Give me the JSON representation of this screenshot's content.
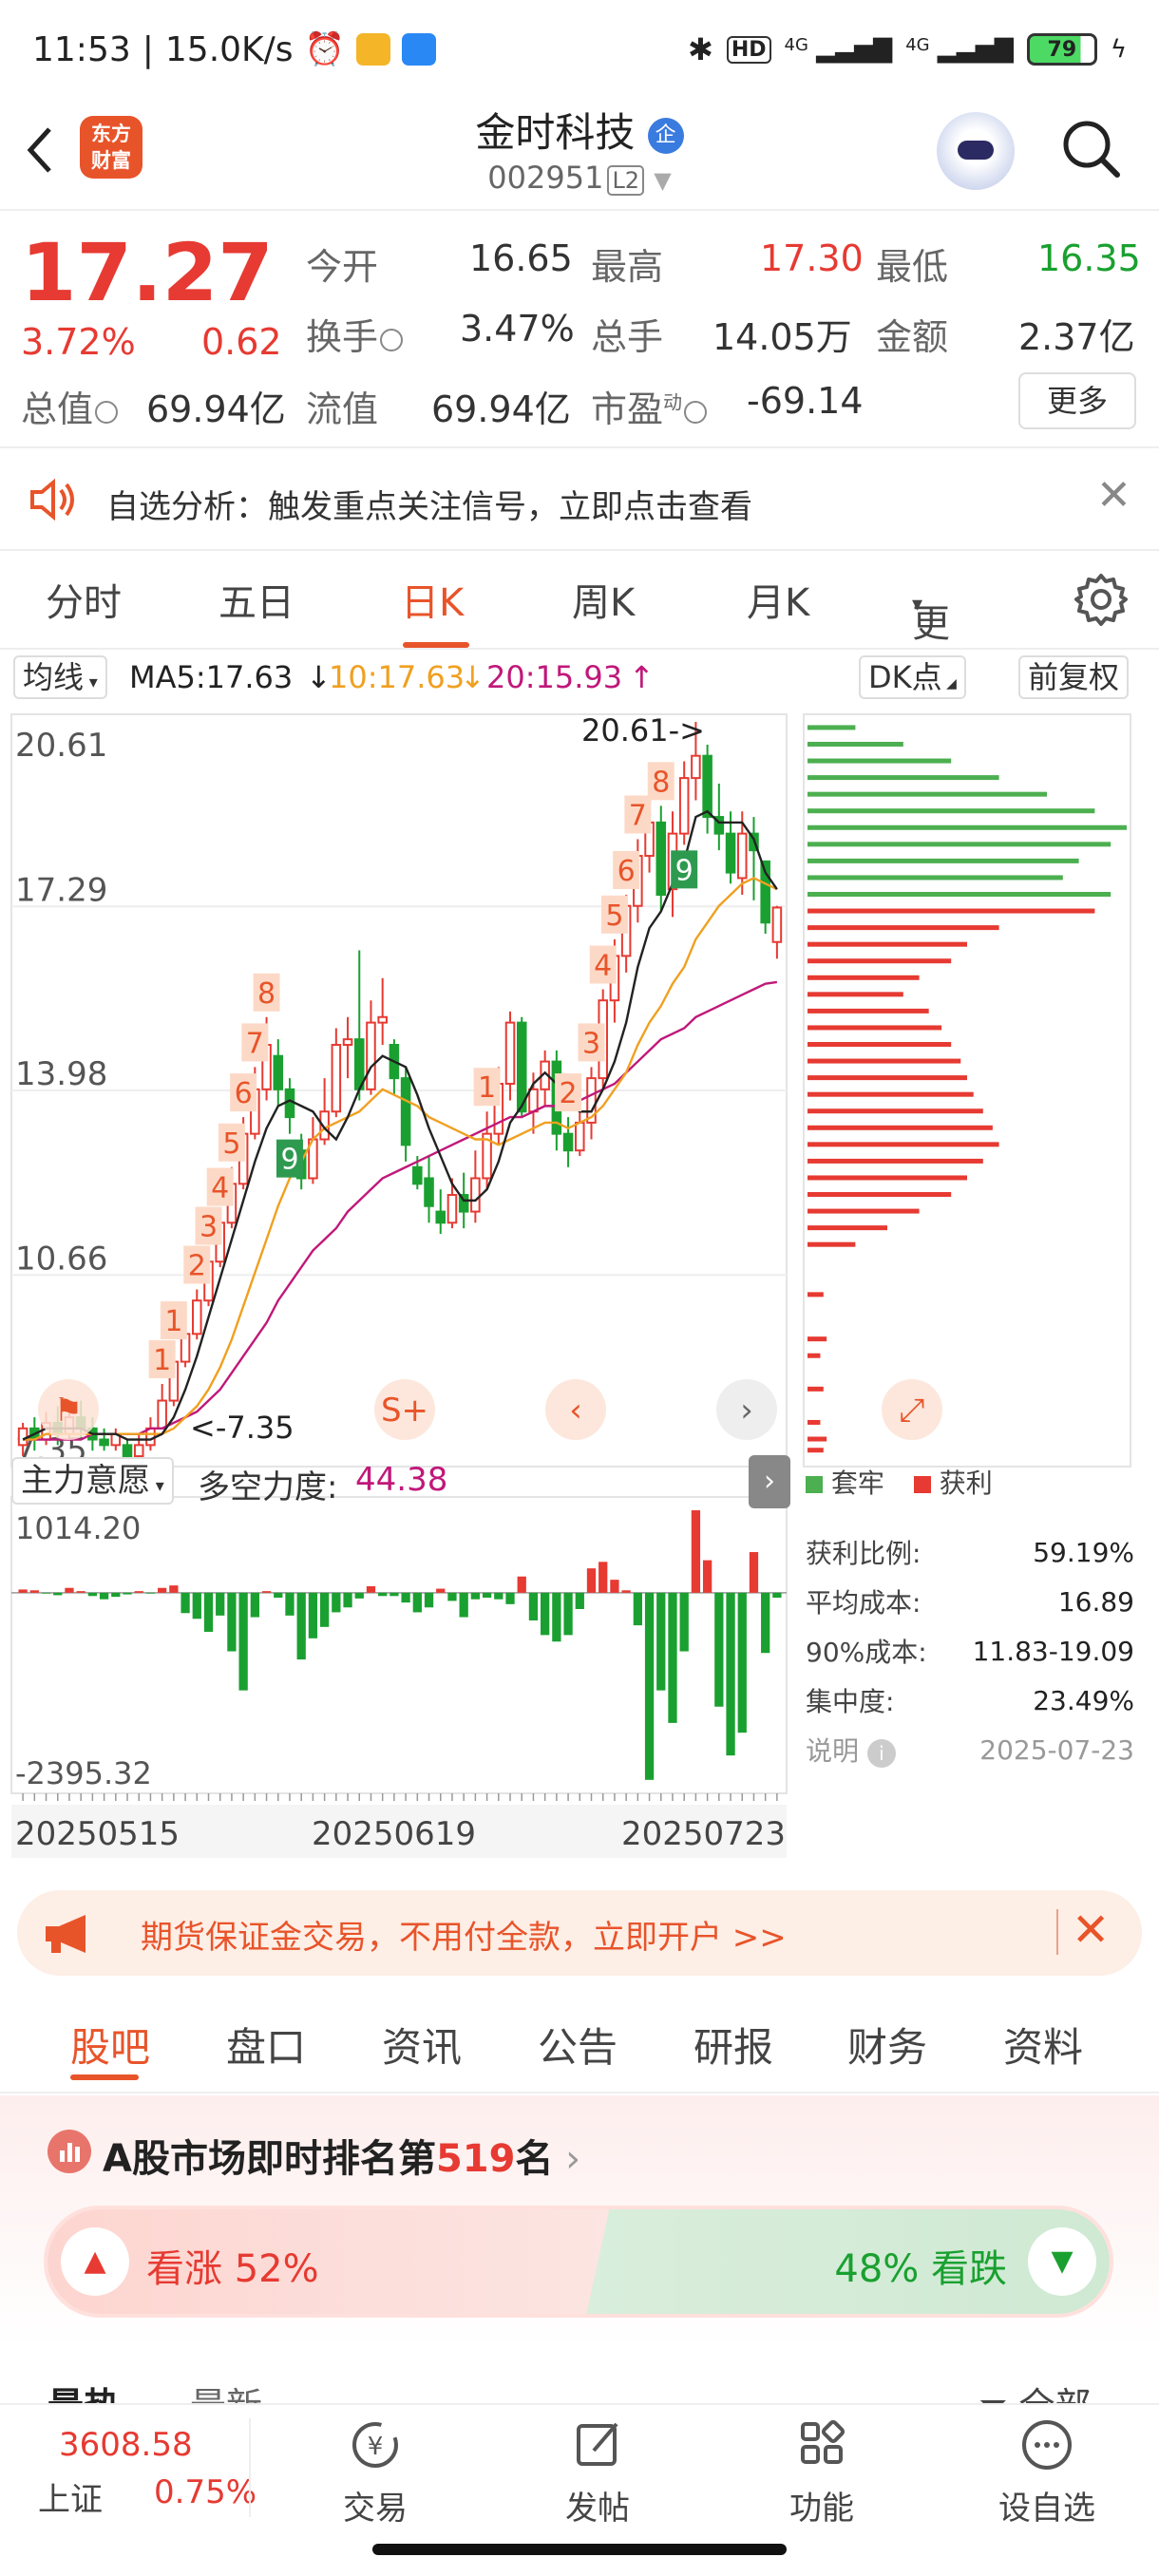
{
  "status_bar": {
    "time": "11:53",
    "net_speed": "15.0K/s",
    "battery": "79",
    "hd": "HD",
    "net1": "4G",
    "net2": "4G"
  },
  "header": {
    "back_icon": "chevron-left-icon",
    "logo_line1": "东方",
    "logo_line2": "财富",
    "stock_name": "金时科技",
    "badge": "企",
    "code": "002951",
    "level": "L2"
  },
  "quote": {
    "price": "17.27",
    "change_pct": "3.72%",
    "change": "0.62",
    "open_label": "今开",
    "open": "16.65",
    "high_label": "最高",
    "high": "17.30",
    "low_label": "最低",
    "low": "16.35",
    "turnover_label": "换手",
    "turnover": "3.47%",
    "volume_label": "总手",
    "volume": "14.05万",
    "amount_label": "金额",
    "amount": "2.37亿",
    "mktcap_label": "总值",
    "mktcap": "69.94亿",
    "float_label": "流值",
    "float": "69.94亿",
    "pe_label": "市盈",
    "pe_sup": "动",
    "pe": "-69.14",
    "more": "更多"
  },
  "alert": {
    "text": "自选分析：触发重点关注信号，立即点击查看"
  },
  "period_tabs": [
    "分时",
    "五日",
    "日K",
    "周K",
    "月K",
    "更多"
  ],
  "active_tab": 2,
  "ma_bar": {
    "type": "均线",
    "ma5": "MA5:17.63",
    "ma10": "10:17.63",
    "ma20": "20:15.93",
    "dk": "DK点",
    "adjust": "前复权"
  },
  "chart_data": {
    "type": "candlestick",
    "title": "",
    "y_ticks": [
      "20.61",
      "17.29",
      "13.98",
      "10.66",
      "7.35"
    ],
    "ylim": [
      7.35,
      20.61
    ],
    "max_label": "20.61->",
    "min_label": "<-7.35",
    "sequence_labels": [
      "1",
      "2",
      "3",
      "4",
      "5",
      "6",
      "7",
      "8",
      "9"
    ],
    "candles": [
      [
        7.6,
        7.9,
        7.4,
        8.0
      ],
      [
        7.9,
        7.7,
        7.5,
        8.1
      ],
      [
        7.7,
        8.0,
        7.6,
        8.2
      ],
      [
        8.0,
        7.8,
        7.6,
        8.3
      ],
      [
        7.8,
        8.1,
        7.7,
        8.3
      ],
      [
        8.1,
        7.9,
        7.7,
        8.4
      ],
      [
        7.9,
        7.7,
        7.5,
        8.1
      ],
      [
        7.7,
        7.6,
        7.5,
        7.9
      ],
      [
        7.6,
        7.8,
        7.5,
        7.9
      ],
      [
        7.6,
        7.4,
        7.35,
        7.7
      ],
      [
        7.4,
        7.6,
        7.35,
        7.8
      ],
      [
        7.6,
        7.9,
        7.5,
        8.1
      ],
      [
        7.9,
        8.4,
        7.9,
        8.7
      ],
      [
        8.4,
        9.1,
        8.3,
        9.4
      ],
      [
        9.1,
        9.6,
        9.0,
        9.8
      ],
      [
        9.6,
        10.2,
        9.5,
        10.4
      ],
      [
        10.2,
        10.9,
        10.1,
        11.1
      ],
      [
        10.9,
        11.6,
        10.8,
        11.8
      ],
      [
        11.6,
        12.3,
        11.5,
        12.6
      ],
      [
        12.3,
        13.2,
        12.2,
        13.5
      ],
      [
        13.2,
        14.0,
        13.1,
        14.4
      ],
      [
        14.0,
        14.8,
        13.8,
        15.3
      ],
      [
        14.6,
        14.0,
        13.7,
        14.9
      ],
      [
        14.0,
        13.5,
        13.2,
        14.2
      ],
      [
        12.9,
        12.4,
        12.2,
        13.2
      ],
      [
        12.4,
        13.1,
        12.3,
        13.5
      ],
      [
        13.1,
        13.6,
        13.0,
        14.2
      ],
      [
        13.6,
        14.8,
        13.5,
        15.1
      ],
      [
        14.8,
        14.9,
        14.2,
        15.3
      ],
      [
        14.9,
        14.0,
        13.8,
        16.5
      ],
      [
        14.0,
        15.2,
        13.9,
        15.6
      ],
      [
        15.2,
        15.3,
        14.8,
        16.0
      ],
      [
        14.8,
        14.2,
        13.9,
        14.9
      ],
      [
        14.2,
        13.0,
        12.7,
        14.4
      ],
      [
        12.6,
        12.3,
        12.2,
        12.8
      ],
      [
        12.4,
        11.9,
        11.6,
        12.8
      ],
      [
        11.8,
        11.6,
        11.4,
        12.2
      ],
      [
        11.6,
        12.1,
        11.5,
        12.4
      ],
      [
        12.1,
        11.8,
        11.5,
        12.5
      ],
      [
        11.8,
        12.4,
        11.6,
        12.9
      ],
      [
        12.4,
        13.2,
        12.2,
        13.6
      ],
      [
        13.2,
        14.1,
        13.0,
        14.4
      ],
      [
        14.1,
        15.2,
        13.8,
        15.4
      ],
      [
        15.2,
        13.6,
        13.5,
        15.3
      ],
      [
        13.6,
        14.0,
        13.2,
        14.3
      ],
      [
        14.0,
        14.5,
        13.7,
        14.7
      ],
      [
        14.5,
        13.2,
        12.9,
        14.7
      ],
      [
        13.2,
        12.9,
        12.6,
        13.5
      ],
      [
        12.9,
        13.4,
        12.8,
        13.7
      ],
      [
        13.4,
        14.2,
        13.1,
        14.4
      ],
      [
        14.2,
        15.6,
        14.0,
        15.8
      ],
      [
        15.6,
        16.4,
        15.2,
        16.7
      ],
      [
        16.4,
        17.3,
        16.1,
        17.5
      ],
      [
        17.3,
        18.2,
        17.0,
        18.5
      ],
      [
        18.2,
        18.8,
        17.9,
        19.1
      ],
      [
        18.8,
        17.5,
        17.2,
        19.1
      ],
      [
        17.6,
        18.6,
        17.1,
        19.0
      ],
      [
        18.6,
        19.6,
        18.4,
        19.9
      ],
      [
        19.6,
        20.0,
        19.2,
        20.61
      ],
      [
        20.0,
        18.9,
        18.6,
        20.2
      ],
      [
        18.9,
        18.6,
        18.3,
        19.5
      ],
      [
        18.6,
        17.9,
        17.7,
        19.0
      ],
      [
        17.8,
        18.6,
        17.5,
        19.0
      ],
      [
        18.6,
        18.3,
        17.4,
        18.9
      ],
      [
        18.1,
        17.0,
        16.8,
        18.1
      ],
      [
        16.65,
        17.27,
        16.35,
        17.3
      ]
    ],
    "ma5": [
      7.7,
      7.8,
      7.9,
      7.9,
      7.9,
      7.9,
      7.8,
      7.8,
      7.8,
      7.7,
      7.7,
      7.7,
      7.8,
      8.1,
      8.6,
      9.2,
      9.9,
      10.6,
      11.3,
      12.0,
      12.7,
      13.3,
      13.7,
      13.8,
      13.7,
      13.6,
      13.3,
      13.1,
      13.5,
      14.0,
      14.4,
      14.6,
      14.5,
      14.4,
      13.9,
      13.3,
      12.8,
      12.3,
      12.0,
      12.0,
      12.2,
      12.7,
      13.4,
      13.7,
      14.1,
      14.3,
      14.1,
      13.8,
      13.6,
      13.6,
      14.0,
      14.5,
      15.2,
      16.2,
      16.9,
      17.2,
      17.7,
      18.1,
      18.9,
      19.0,
      18.8,
      18.8,
      18.8,
      18.5,
      17.9,
      17.6
    ],
    "ma10": [
      7.7,
      7.7,
      7.8,
      7.8,
      7.8,
      7.8,
      7.8,
      7.8,
      7.8,
      7.8,
      7.8,
      7.8,
      7.8,
      7.9,
      8.1,
      8.3,
      8.6,
      9.0,
      9.5,
      10.1,
      10.7,
      11.3,
      11.9,
      12.4,
      12.7,
      13.1,
      13.3,
      13.4,
      13.5,
      13.6,
      13.8,
      14.0,
      13.9,
      13.8,
      13.7,
      13.5,
      13.4,
      13.3,
      13.2,
      13.1,
      13.1,
      13.0,
      13.1,
      13.2,
      13.3,
      13.4,
      13.4,
      13.3,
      13.4,
      13.5,
      13.7,
      14.0,
      14.3,
      14.8,
      15.2,
      15.5,
      15.9,
      16.2,
      16.7,
      17.0,
      17.3,
      17.5,
      17.7,
      17.8,
      17.7,
      17.6
    ],
    "ma20": [
      7.7,
      7.7,
      7.7,
      7.7,
      7.7,
      7.7,
      7.8,
      7.8,
      7.8,
      7.8,
      7.8,
      7.9,
      7.9,
      8.0,
      8.1,
      8.2,
      8.4,
      8.6,
      8.9,
      9.2,
      9.5,
      9.8,
      10.2,
      10.5,
      10.8,
      11.1,
      11.3,
      11.5,
      11.8,
      12.0,
      12.2,
      12.4,
      12.5,
      12.6,
      12.7,
      12.8,
      12.9,
      13.0,
      13.1,
      13.2,
      13.3,
      13.4,
      13.5,
      13.5,
      13.6,
      13.7,
      13.7,
      13.8,
      13.8,
      13.9,
      14.0,
      14.1,
      14.3,
      14.5,
      14.7,
      14.9,
      15.0,
      15.1,
      15.3,
      15.4,
      15.5,
      15.6,
      15.7,
      15.8,
      15.9,
      15.93
    ],
    "flow": [
      40,
      30,
      -10,
      -30,
      60,
      20,
      -40,
      -80,
      -50,
      -20,
      20,
      -10,
      60,
      90,
      -250,
      -320,
      -480,
      -280,
      -720,
      -1200,
      -300,
      20,
      -60,
      -280,
      -820,
      -560,
      -420,
      -240,
      -180,
      -70,
      80,
      -40,
      -40,
      -120,
      -240,
      -180,
      50,
      -100,
      -300,
      -80,
      -60,
      -80,
      -140,
      200,
      -340,
      -520,
      -600,
      -520,
      -200,
      300,
      380,
      160,
      30,
      -400,
      -2300,
      -1200,
      -1600,
      -720,
      1014,
      400,
      -1400,
      -2000,
      -1720,
      500,
      -740,
      -60
    ],
    "flow_ylim": [
      -2395.32,
      1014.2
    ],
    "flow_ticks": [
      "1014.20",
      "-2395.32"
    ],
    "dates": [
      "20250515",
      "20250619",
      "20250723"
    ]
  },
  "chart_controls": {
    "s_icon": "S+",
    "prev": "chevron-left-icon",
    "next": "chevron-right-icon",
    "expand": "expand-icon"
  },
  "indicator": {
    "name": "主力意愿",
    "label": "多空力度:",
    "value": "44.38"
  },
  "chips": {
    "legend_trapped": "套牢",
    "legend_profit": "获利",
    "profit_ratio_label": "获利比例:",
    "profit_ratio": "59.19%",
    "avg_cost_label": "平均成本:",
    "avg_cost": "16.89",
    "cost90_label": "90%成本:",
    "cost90": "11.83-19.09",
    "concentration_label": "集中度:",
    "concentration": "23.49%",
    "note_label": "说明",
    "date": "2025-07-23",
    "bars": [
      {
        "price": 20.5,
        "v": 0.15,
        "c": "g"
      },
      {
        "price": 20.2,
        "v": 0.3,
        "c": "g"
      },
      {
        "price": 19.9,
        "v": 0.45,
        "c": "g"
      },
      {
        "price": 19.6,
        "v": 0.6,
        "c": "g"
      },
      {
        "price": 19.3,
        "v": 0.75,
        "c": "g"
      },
      {
        "price": 19.0,
        "v": 0.9,
        "c": "g"
      },
      {
        "price": 18.7,
        "v": 1.0,
        "c": "g"
      },
      {
        "price": 18.4,
        "v": 0.95,
        "c": "g"
      },
      {
        "price": 18.1,
        "v": 0.85,
        "c": "g"
      },
      {
        "price": 17.8,
        "v": 0.8,
        "c": "g"
      },
      {
        "price": 17.5,
        "v": 0.95,
        "c": "g"
      },
      {
        "price": 17.2,
        "v": 0.9,
        "c": "r"
      },
      {
        "price": 16.9,
        "v": 0.6,
        "c": "r"
      },
      {
        "price": 16.6,
        "v": 0.5,
        "c": "r"
      },
      {
        "price": 16.3,
        "v": 0.45,
        "c": "r"
      },
      {
        "price": 16.0,
        "v": 0.35,
        "c": "r"
      },
      {
        "price": 15.7,
        "v": 0.3,
        "c": "r"
      },
      {
        "price": 15.4,
        "v": 0.38,
        "c": "r"
      },
      {
        "price": 15.1,
        "v": 0.42,
        "c": "r"
      },
      {
        "price": 14.8,
        "v": 0.45,
        "c": "r"
      },
      {
        "price": 14.5,
        "v": 0.48,
        "c": "r"
      },
      {
        "price": 14.2,
        "v": 0.5,
        "c": "r"
      },
      {
        "price": 13.9,
        "v": 0.52,
        "c": "r"
      },
      {
        "price": 13.6,
        "v": 0.55,
        "c": "r"
      },
      {
        "price": 13.3,
        "v": 0.58,
        "c": "r"
      },
      {
        "price": 13.0,
        "v": 0.6,
        "c": "r"
      },
      {
        "price": 12.7,
        "v": 0.55,
        "c": "r"
      },
      {
        "price": 12.4,
        "v": 0.5,
        "c": "r"
      },
      {
        "price": 12.1,
        "v": 0.45,
        "c": "r"
      },
      {
        "price": 11.8,
        "v": 0.35,
        "c": "r"
      },
      {
        "price": 11.5,
        "v": 0.25,
        "c": "r"
      },
      {
        "price": 11.2,
        "v": 0.15,
        "c": "r"
      },
      {
        "price": 10.3,
        "v": 0.05,
        "c": "r"
      },
      {
        "price": 9.5,
        "v": 0.06,
        "c": "r"
      },
      {
        "price": 9.2,
        "v": 0.04,
        "c": "r"
      },
      {
        "price": 8.6,
        "v": 0.05,
        "c": "r"
      },
      {
        "price": 8.0,
        "v": 0.04,
        "c": "r"
      },
      {
        "price": 7.7,
        "v": 0.06,
        "c": "r"
      },
      {
        "price": 7.5,
        "v": 0.05,
        "c": "r"
      }
    ]
  },
  "promo": {
    "text": "期货保证金交易，不用付全款，立即开户 >>",
    "icon": "megaphone-icon"
  },
  "sub_tabs": [
    "股吧",
    "盘口",
    "资讯",
    "公告",
    "研报",
    "财务",
    "资料"
  ],
  "rank": {
    "prefix": "A股市场即时排名第",
    "num": "519",
    "suffix": "名",
    "up_label": "看涨 52%",
    "down_label": "48% 看跌",
    "up_pct": 52,
    "hot": "最热",
    "new": "最新",
    "all": "全部"
  },
  "bottom": {
    "index_value": "3608.58",
    "index_name": "上证",
    "index_change": "0.75%",
    "trade": "交易",
    "post": "发帖",
    "func": "功能",
    "watch": "设自选"
  }
}
